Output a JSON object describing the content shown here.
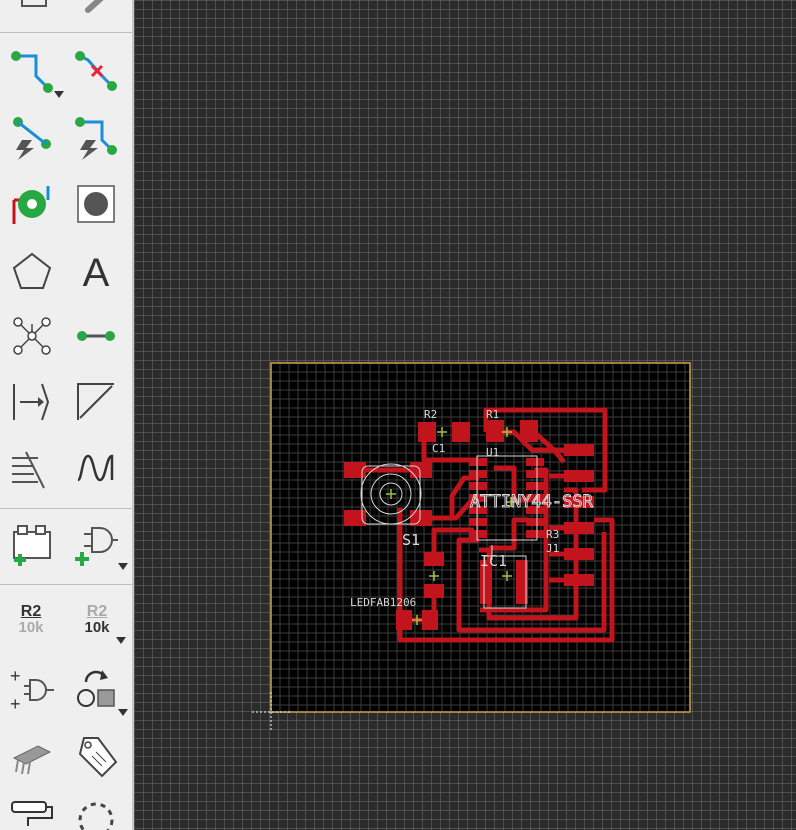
{
  "toolbar": {
    "tools": [
      {
        "name": "route-manual",
        "icon": "route-wire-icon"
      },
      {
        "name": "ripup",
        "icon": "ripup-route-icon"
      },
      {
        "name": "autoroute-fanout",
        "icon": "fanout-icon"
      },
      {
        "name": "autoroute",
        "icon": "autoroute-icon"
      },
      {
        "name": "via",
        "icon": "via-icon"
      },
      {
        "name": "hole",
        "icon": "hole-icon"
      },
      {
        "name": "polygon",
        "icon": "polygon-icon"
      },
      {
        "name": "text",
        "icon": "text-icon",
        "label": "A"
      },
      {
        "name": "ratsnest",
        "icon": "ratsnest-icon"
      },
      {
        "name": "wire",
        "icon": "wire-icon"
      },
      {
        "name": "dimension-in",
        "icon": "dimension-icon"
      },
      {
        "name": "miter",
        "icon": "miter-icon"
      },
      {
        "name": "optimize",
        "icon": "optimize-icon"
      },
      {
        "name": "meander",
        "icon": "meander-icon"
      },
      {
        "name": "add-part",
        "icon": "add-part-icon"
      },
      {
        "name": "add-gate",
        "icon": "add-gate-icon"
      },
      {
        "name": "name-value-1",
        "label_top": "R2",
        "label_bottom": "10k"
      },
      {
        "name": "name-value-2",
        "label_top": "R2",
        "label_bottom": "10k"
      },
      {
        "name": "invoke",
        "icon": "invoke-gate-icon"
      },
      {
        "name": "rotate-mirror",
        "icon": "rotate-icon"
      },
      {
        "name": "package",
        "icon": "package-icon"
      },
      {
        "name": "attribute",
        "icon": "tag-icon"
      },
      {
        "name": "paint",
        "icon": "paint-roller-icon"
      },
      {
        "name": "select-group",
        "icon": "dashed-circle-icon"
      }
    ]
  },
  "board": {
    "labels": {
      "r2": "R2",
      "attiny": "ATTINY44-SSR",
      "s1": "S1",
      "ic1": "IC1",
      "led": "LEDFAB1206",
      "c1": "C1",
      "u1": "U1",
      "r1": "R1",
      "r3": "R3",
      "j1": "J1"
    },
    "colors": {
      "copper": "#c1141c",
      "outline": "#c9a54a",
      "silk": "#d8d8d8",
      "origin": "#9fc242"
    }
  }
}
